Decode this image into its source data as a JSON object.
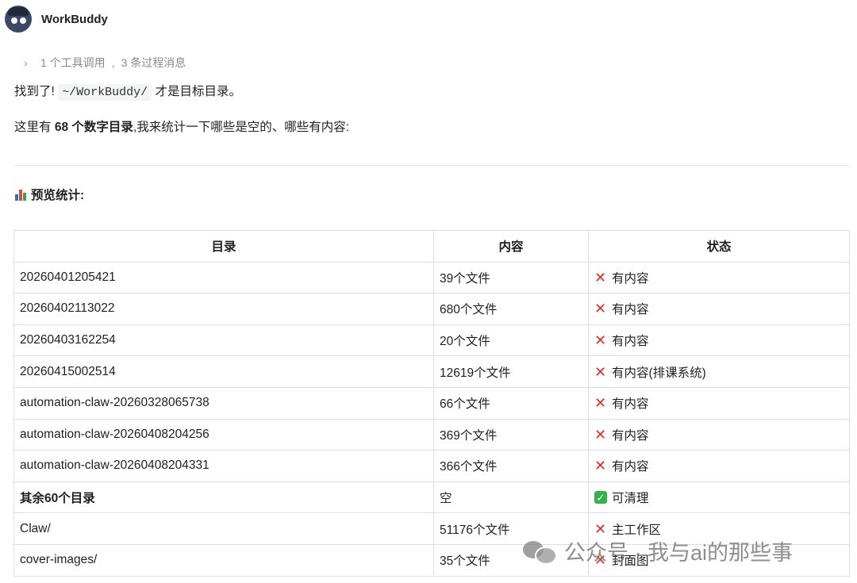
{
  "header": {
    "app_name": "WorkBuddy",
    "avatar_icon": "robot-avatar-icon"
  },
  "tool_summary": {
    "tool_calls": "1 个工具调用",
    "separator": ",",
    "process_messages": "3 条过程消息"
  },
  "message": {
    "line1_prefix": "找到了!",
    "line1_code": "~/WorkBuddy/",
    "line1_suffix": "才是目标目录。",
    "line2_prefix": "这里有",
    "line2_bold": "68 个数字目录",
    "line2_suffix": ",我来统计一下哪些是空的、哪些有内容:"
  },
  "section": {
    "icon": "bar-chart-icon",
    "title": "预览统计:"
  },
  "table": {
    "headers": [
      "目录",
      "内容",
      "状态"
    ],
    "rows": [
      {
        "dir": "20260401205421",
        "content": "39个文件",
        "status": "有内容",
        "status_icon": "cross"
      },
      {
        "dir": "20260402113022",
        "content": "680个文件",
        "status": "有内容",
        "status_icon": "cross"
      },
      {
        "dir": "20260403162254",
        "content": "20个文件",
        "status": "有内容",
        "status_icon": "cross"
      },
      {
        "dir": "20260415002514",
        "content": "12619个文件",
        "status": "有内容(排课系统)",
        "status_icon": "cross"
      },
      {
        "dir": "automation-claw-20260328065738",
        "content": "66个文件",
        "status": "有内容",
        "status_icon": "cross"
      },
      {
        "dir": "automation-claw-20260408204256",
        "content": "369个文件",
        "status": "有内容",
        "status_icon": "cross"
      },
      {
        "dir": "automation-claw-20260408204331",
        "content": "366个文件",
        "status": "有内容",
        "status_icon": "cross"
      },
      {
        "dir": "其余60个目录",
        "content": "空",
        "status": "可清理",
        "status_icon": "check"
      },
      {
        "dir": "Claw/",
        "content": "51176个文件",
        "status": "主工作区",
        "status_icon": "cross"
      },
      {
        "dir": "cover-images/",
        "content": "35个文件",
        "status": "封面图",
        "status_icon": "cross"
      }
    ]
  },
  "watermark": {
    "text": "公众号 · 我与ai的那些事",
    "icon": "wechat-icon"
  },
  "colors": {
    "cross": "#e32b2b",
    "check": "#35b34a",
    "border": "#dcdfe4"
  }
}
